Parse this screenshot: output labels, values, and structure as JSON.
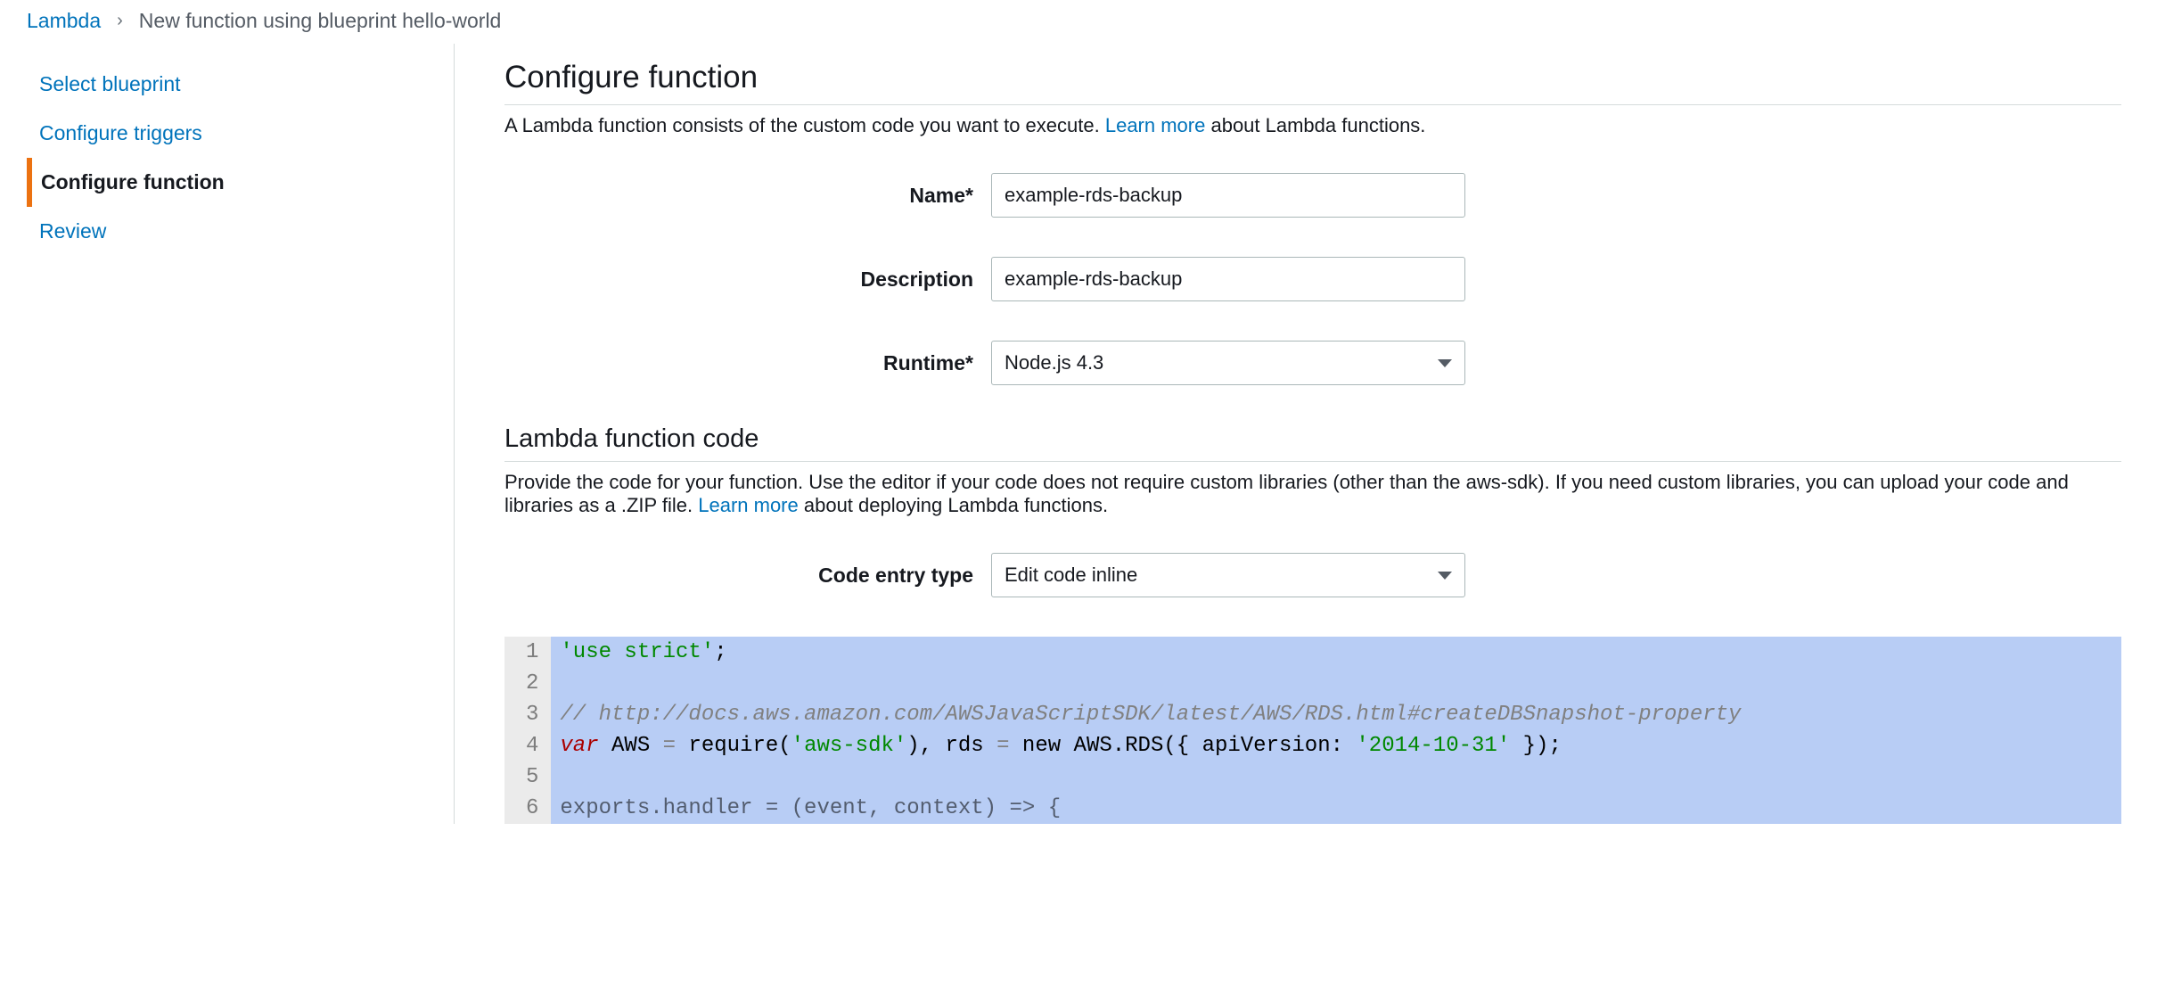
{
  "breadcrumb": {
    "root": "Lambda",
    "current": "New function using blueprint hello-world"
  },
  "sidebar": {
    "steps": [
      "Select blueprint",
      "Configure triggers",
      "Configure function",
      "Review"
    ],
    "activeIndex": 2
  },
  "configure": {
    "title": "Configure function",
    "descPrefix": "A Lambda function consists of the custom code you want to execute. ",
    "learnMore": "Learn more",
    "descSuffix": " about Lambda functions.",
    "fields": {
      "nameLabel": "Name*",
      "nameValue": "example-rds-backup",
      "descriptionLabel": "Description",
      "descriptionValue": "example-rds-backup",
      "runtimeLabel": "Runtime*",
      "runtimeValue": "Node.js 4.3"
    }
  },
  "codeSection": {
    "title": "Lambda function code",
    "descPrefix": "Provide the code for your function. Use the editor if your code does not require custom libraries (other than the aws-sdk). If you need custom libraries, you can upload your code and libraries as a .ZIP file. ",
    "learnMore": "Learn more",
    "descSuffix": " about deploying Lambda functions.",
    "entryTypeLabel": "Code entry type",
    "entryTypeValue": "Edit code inline",
    "lineNumbers": [
      "1",
      "2",
      "3",
      "4",
      "5",
      "6"
    ],
    "lines": {
      "l1_str": "'use strict'",
      "l1_semi": ";",
      "l2": "",
      "l3_comment": "// http://docs.aws.amazon.com/AWSJavaScriptSDK/latest/AWS/RDS.html#createDBSnapshot-property",
      "l4_var": "var",
      "l4_mid1": " AWS ",
      "l4_eq1": "=",
      "l4_mid2": " require(",
      "l4_str1": "'aws-sdk'",
      "l4_mid3": "), rds ",
      "l4_eq2": "=",
      "l4_mid4": " new AWS.RDS({ apiVersion: ",
      "l4_str2": "'2014-10-31'",
      "l4_mid5": " });",
      "l5": "",
      "l6": "exports.handler = (event, context) => {"
    }
  }
}
